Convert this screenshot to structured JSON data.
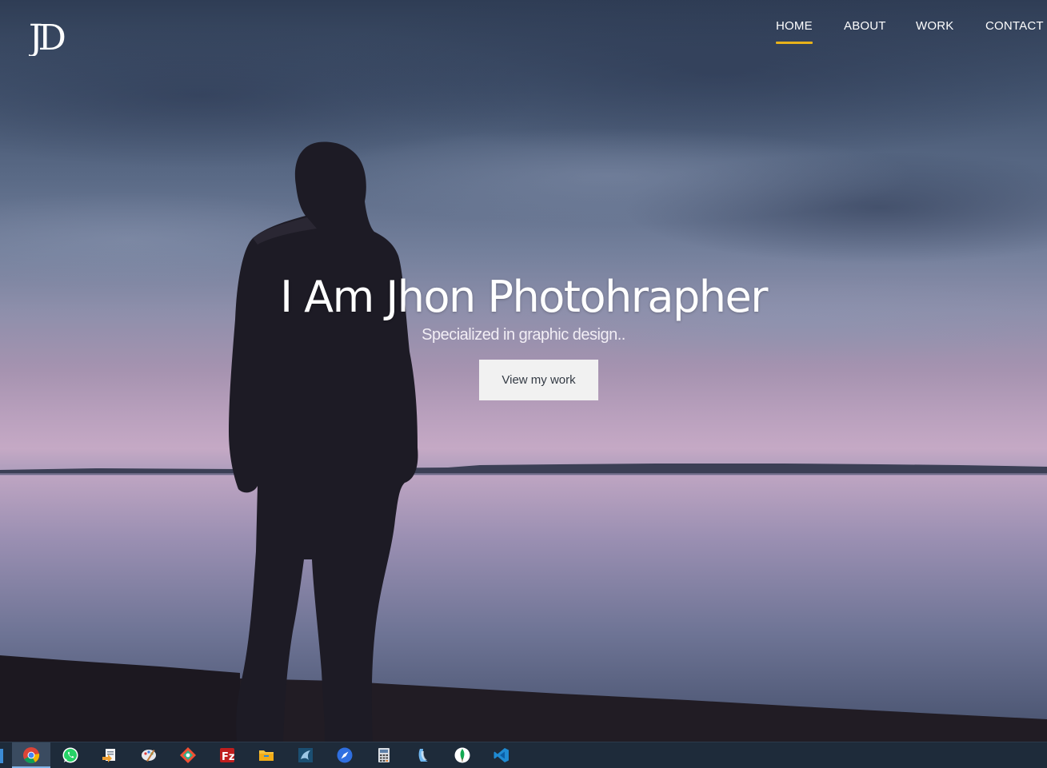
{
  "header": {
    "logo_text": "JD",
    "nav": [
      {
        "label": "HOME",
        "active": true
      },
      {
        "label": "ABOUT",
        "active": false
      },
      {
        "label": "WORK",
        "active": false
      },
      {
        "label": "CONTACT",
        "active": false
      }
    ],
    "accent_color": "#e8b21a"
  },
  "hero": {
    "title": "I Am Jhon Photohrapher",
    "subtitle": "Specialized in graphic design..",
    "cta_label": "View my work"
  },
  "taskbar": {
    "icons": [
      {
        "name": "chrome-icon",
        "active": true
      },
      {
        "name": "whatsapp-icon",
        "active": false
      },
      {
        "name": "file-transfer-icon",
        "active": false
      },
      {
        "name": "paint-palette-icon",
        "active": false
      },
      {
        "name": "git-kraken-icon",
        "active": false
      },
      {
        "name": "filezilla-icon",
        "active": false
      },
      {
        "name": "file-explorer-icon",
        "active": false
      },
      {
        "name": "mysql-workbench-icon",
        "active": false
      },
      {
        "name": "compass-icon",
        "active": false
      },
      {
        "name": "calculator-icon",
        "active": false
      },
      {
        "name": "laragon-icon",
        "active": false
      },
      {
        "name": "mongodb-icon",
        "active": false
      },
      {
        "name": "vscode-icon",
        "active": false
      }
    ]
  }
}
